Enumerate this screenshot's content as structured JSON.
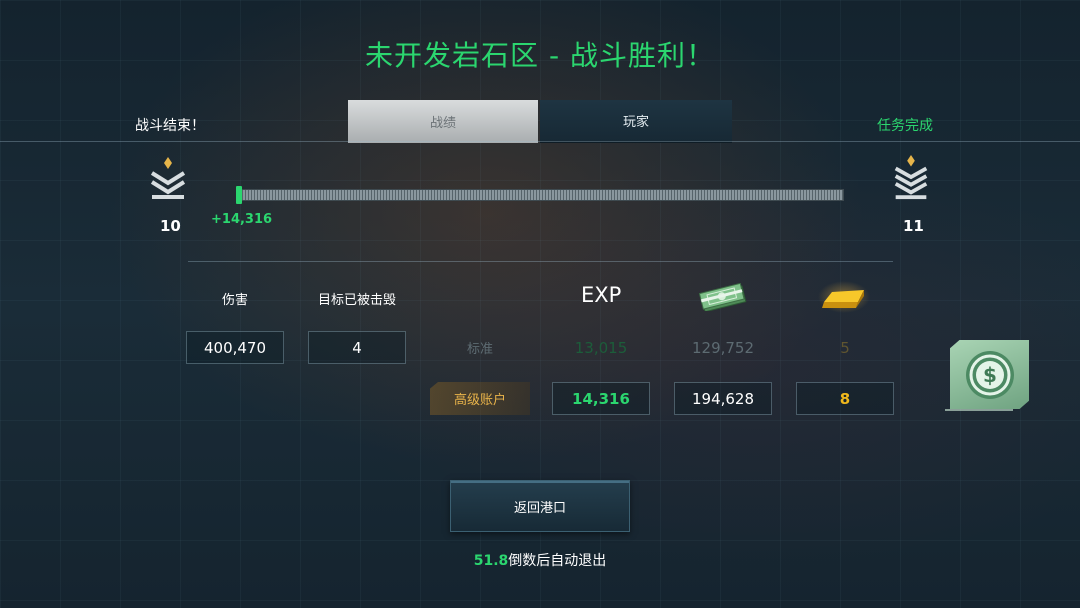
{
  "header": {
    "title": "未开发岩石区 - 战斗胜利！",
    "left_status": "战斗结束！",
    "right_status": "任务完成"
  },
  "tabs": [
    {
      "label": "战绩",
      "active": true
    },
    {
      "label": "玩家",
      "active": false
    }
  ],
  "progression": {
    "current_rank": "10",
    "next_rank": "11",
    "xp_gained": "+14,316",
    "progress_fraction": 0.01
  },
  "stats": {
    "damage_label": "伤害",
    "damage_value": "400,470",
    "destroyed_label": "目标已被击毁",
    "destroyed_value": "4"
  },
  "rewards": {
    "exp_header": "EXP",
    "credits_icon": "money-icon",
    "gold_icon": "gold-bar-icon",
    "standard": {
      "label": "标准",
      "exp": "13,015",
      "credits": "129,752",
      "gold": "5"
    },
    "premium": {
      "label": "高级账户",
      "exp": "14,316",
      "credits": "194,628",
      "gold": "8"
    }
  },
  "actions": {
    "return_label": "返回港口",
    "countdown_value": "51.8",
    "countdown_suffix": "倒数后自动退出"
  },
  "colors": {
    "accent_green": "#2bd66f",
    "gold": "#f0b81c",
    "premium_label": "#e8b34a"
  }
}
